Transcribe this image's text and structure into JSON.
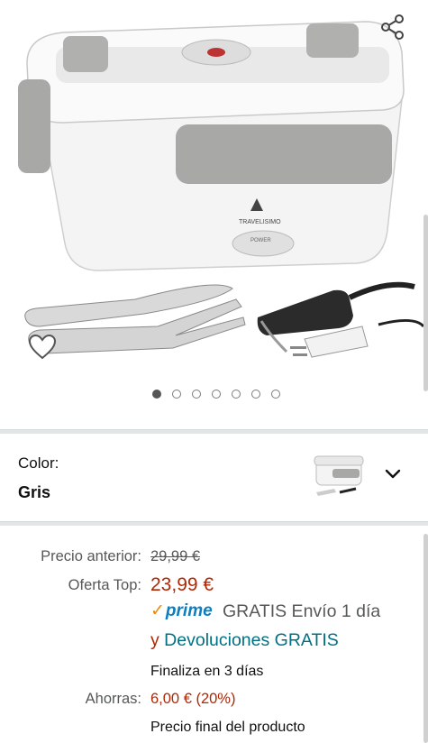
{
  "gallery": {
    "image_count": 7,
    "active_index": 0,
    "brand": "TRAVELISIMO",
    "power_label": "POWER"
  },
  "color_selector": {
    "label": "Color:",
    "value": "Gris"
  },
  "pricing": {
    "previous_label": "Precio anterior:",
    "previous_value": "29,99 €",
    "offer_label": "Oferta Top:",
    "offer_value": "23,99 €",
    "prime_logo": "prime",
    "shipping_text": "GRATIS Envío 1 día",
    "returns_prefix": "y",
    "returns_link": "Devoluciones GRATIS",
    "ends_text": "Finaliza en 3 días",
    "savings_label": "Ahorras:",
    "savings_value": "6,00 € (20%)",
    "final_text": "Precio final del producto"
  },
  "colors": {
    "price_red": "#b12704",
    "link_teal": "#007185",
    "prime_blue": "#0d7fc1",
    "prime_check": "#f08804",
    "product_gray": "#a8a8a6"
  }
}
